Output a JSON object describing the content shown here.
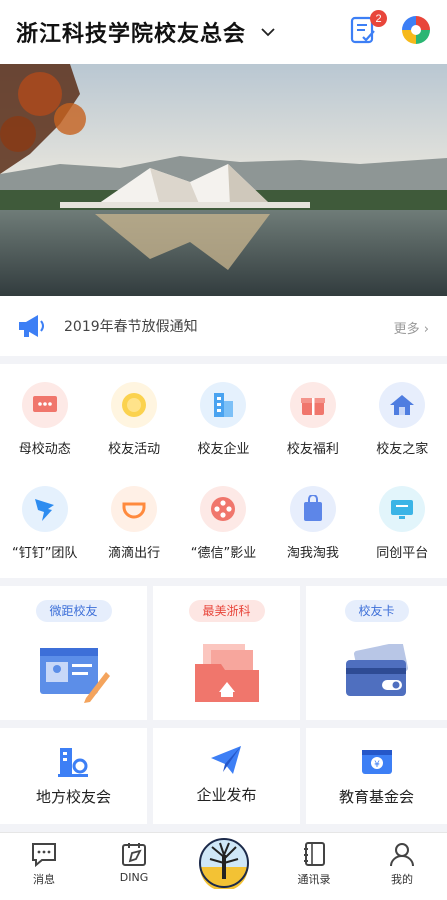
{
  "header": {
    "title": "浙江科技学院校友总会",
    "badge_count": "2"
  },
  "notice": {
    "text": "2019年春节放假通知",
    "more": "更多"
  },
  "grid": {
    "row1": [
      {
        "label": "母校动态",
        "icon": "news-icon"
      },
      {
        "label": "校友活动",
        "icon": "activity-icon"
      },
      {
        "label": "校友企业",
        "icon": "building-icon"
      },
      {
        "label": "校友福利",
        "icon": "gift-icon"
      },
      {
        "label": "校友之家",
        "icon": "home-icon"
      }
    ],
    "row2": [
      {
        "label": "“钉钉”团队",
        "icon": "dingtalk-icon"
      },
      {
        "label": "滴滴出行",
        "icon": "didi-icon"
      },
      {
        "label": "“德信”影业",
        "icon": "film-icon"
      },
      {
        "label": "淘我淘我",
        "icon": "shopping-bag-icon"
      },
      {
        "label": "同创平台",
        "icon": "platform-icon"
      }
    ]
  },
  "cards": {
    "top": [
      {
        "pill": "微距校友"
      },
      {
        "pill": "最美浙科"
      },
      {
        "pill": "校友卡"
      }
    ],
    "bottom": [
      {
        "label": "地方校友会"
      },
      {
        "label": "企业发布"
      },
      {
        "label": "教育基金会"
      }
    ]
  },
  "tabbar": {
    "messages": "消息",
    "ding": "DING",
    "contacts": "通讯录",
    "mine": "我的"
  },
  "colors": {
    "accent": "#3d7ff5",
    "badge": "#e8463b",
    "pink": "#f0766c"
  }
}
